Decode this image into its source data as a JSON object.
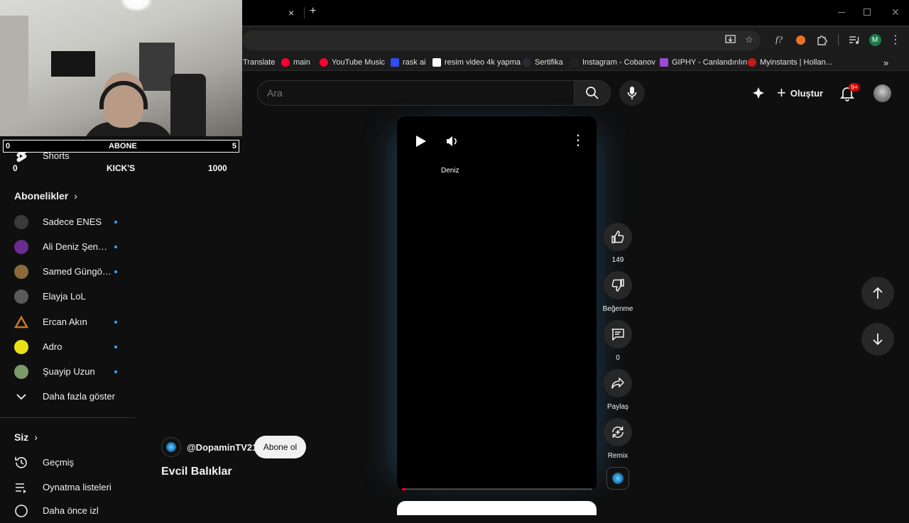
{
  "browser": {
    "tab_close": "×",
    "tab_new": "+",
    "bookmarks": [
      {
        "label": "Translate",
        "color": "#4285f4"
      },
      {
        "label": "main",
        "color": "#ff0033"
      },
      {
        "label": "YouTube Music",
        "color": "#ff0033"
      },
      {
        "label": "rask ai",
        "color": "#2f4cf5"
      },
      {
        "label": "resim video 4k yapma",
        "color": "#ffffff"
      },
      {
        "label": "Sertifika",
        "color": "#2a2a36"
      },
      {
        "label": "Instagram - Cobanov",
        "color": "#222222"
      },
      {
        "label": "GIPHY - Canlandırılın",
        "color": "#9c4ad8"
      },
      {
        "label": "Myinstants | Hollan...",
        "color": "#c21a1a"
      }
    ],
    "profile_initial": "M"
  },
  "overlay": {
    "sub_left": "0",
    "sub_label": "ABONE",
    "sub_right": "5",
    "kick_left": "0",
    "kick_label": "KICK'S",
    "kick_right": "1000"
  },
  "header": {
    "search_placeholder": "Ara",
    "create_label": "Oluştur",
    "notif_badge": "9+"
  },
  "sidebar": {
    "shorts_label": "Shorts",
    "subs_heading": "Abonelikler",
    "subscriptions": [
      {
        "name": "Sadece ENES",
        "dot": true,
        "color": "#3a3a3a"
      },
      {
        "name": "Ali Deniz Şenpot...",
        "dot": true,
        "color": "#6a2c8f"
      },
      {
        "name": "Samed Güngör L...",
        "dot": true,
        "color": "#8a6a3a"
      },
      {
        "name": "Elayja LoL",
        "dot": false,
        "color": "#5a5a5a"
      },
      {
        "name": "Ercan Akın",
        "dot": true,
        "color": "#c57a2a"
      },
      {
        "name": "Adro",
        "dot": true,
        "color": "#e8e214"
      },
      {
        "name": "Şuayip Uzun",
        "dot": true,
        "color": "#7a9a6a"
      }
    ],
    "show_more": "Daha fazla göster",
    "you_heading": "Siz",
    "history": "Geçmiş",
    "playlists": "Oynatma listeleri",
    "next_item": "Daha önce izl"
  },
  "short": {
    "title_overlay": "Deniz",
    "channel_handle": "@DopaminTV21",
    "subscribe_label": "Abone ol",
    "title": "Evcil Balıklar",
    "progress": 0.02,
    "likes": "149",
    "dislike_label": "Beğenme",
    "comments": "0",
    "share_label": "Paylaş",
    "remix_label": "Remix"
  }
}
